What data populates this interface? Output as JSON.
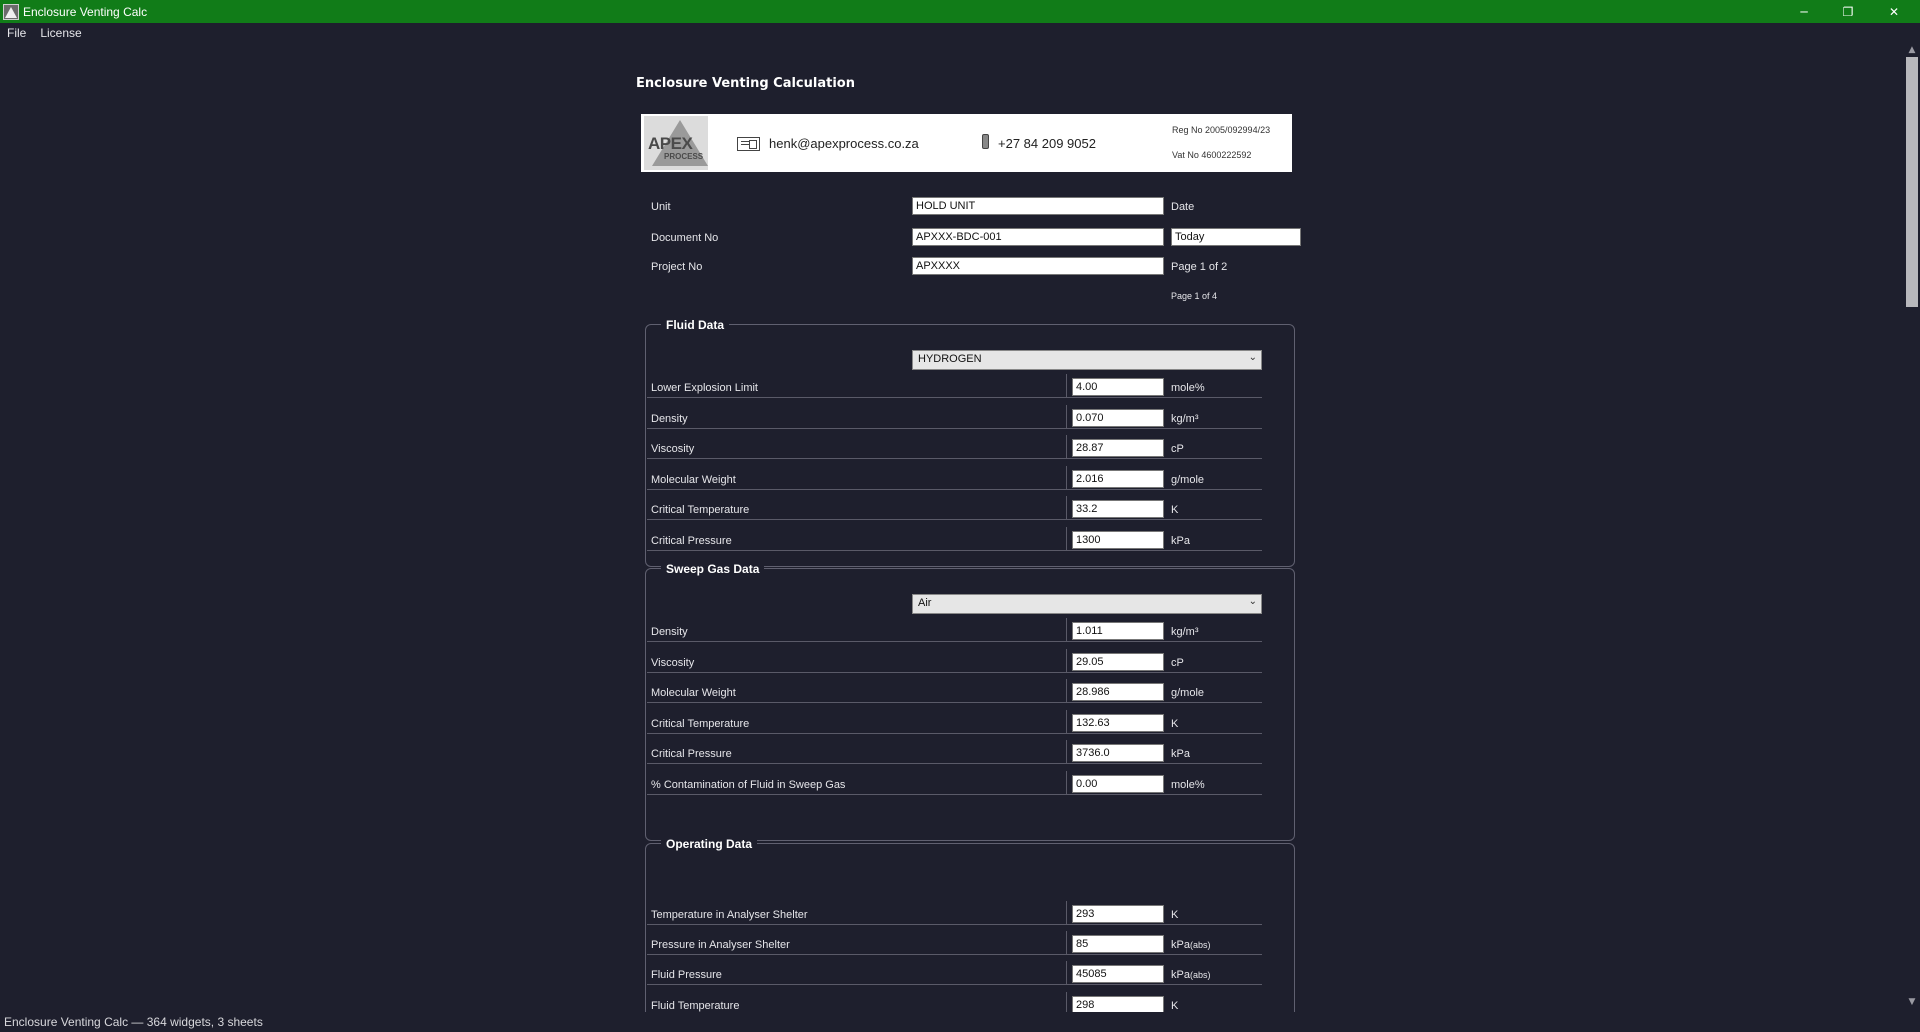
{
  "window": {
    "title": "Enclosure Venting Calc",
    "minimize_glyph": "─",
    "restore_glyph": "❐",
    "close_glyph": "✕"
  },
  "menu": [
    "File",
    "License"
  ],
  "page_title": "Enclosure Venting Calculation",
  "header": {
    "logo_text": "APEX",
    "logo_sub": "PROCESS",
    "email": "henk@apexprocess.co.za",
    "phone": "+27 84 209 9052",
    "reg_no": "Reg No 2005/092994/23",
    "vat_no": "Vat No  4600222592"
  },
  "doc_info": {
    "unit_label": "Unit",
    "unit_value": "HOLD UNIT",
    "date_label": "Date",
    "date_value": "Today",
    "doc_no_label": "Document No",
    "doc_no_value": "APXXX-BDC-001",
    "project_no_label": "Project No",
    "project_no_value": "APXXXX",
    "page_text_1": "Page 1 of 2",
    "page_text_2": "Page 1 of 4"
  },
  "fluid_data": {
    "title": "Fluid Data",
    "selected_fluid": "HYDROGEN",
    "rows": [
      {
        "label": "Lower Explosion Limit",
        "value": "4.00",
        "unit": "mole%"
      },
      {
        "label": "Density",
        "value": "0.070",
        "unit": "kg/m³"
      },
      {
        "label": "Viscosity",
        "value": "28.87",
        "unit": "cP"
      },
      {
        "label": "Molecular Weight",
        "value": "2.016",
        "unit": "g/mole"
      },
      {
        "label": "Critical Temperature",
        "value": "33.2",
        "unit": "K"
      },
      {
        "label": "Critical Pressure",
        "value": "1300",
        "unit": "kPa"
      }
    ]
  },
  "sweep_gas_data": {
    "title": "Sweep Gas Data",
    "selected_gas": "Air",
    "rows": [
      {
        "label": "Density",
        "value": "1.011",
        "unit": "kg/m³"
      },
      {
        "label": "Viscosity",
        "value": "29.05",
        "unit": "cP"
      },
      {
        "label": "Molecular Weight",
        "value": "28.986",
        "unit": "g/mole"
      },
      {
        "label": "Critical Temperature",
        "value": "132.63",
        "unit": "K"
      },
      {
        "label": "Critical Pressure",
        "value": "3736.0",
        "unit": "kPa"
      },
      {
        "label": "% Contamination of Fluid in Sweep Gas",
        "value": "0.00",
        "unit": "mole%"
      }
    ]
  },
  "operating_data": {
    "title": "Operating Data",
    "rows": [
      {
        "label": "Temperature in Analyser Shelter",
        "value": "293",
        "unit": "K",
        "unit_sub": ""
      },
      {
        "label": "Pressure  in Analyser Shelter",
        "value": "85",
        "unit": "kPa",
        "unit_sub": "(abs)"
      },
      {
        "label": "Fluid Pressure",
        "value": "45085",
        "unit": "kPa",
        "unit_sub": "(abs)"
      },
      {
        "label": "Fluid Temperature",
        "value": "298",
        "unit": "K",
        "unit_sub": ""
      }
    ]
  },
  "status": "Enclosure Venting Calc — 364 widgets, 3 sheets"
}
